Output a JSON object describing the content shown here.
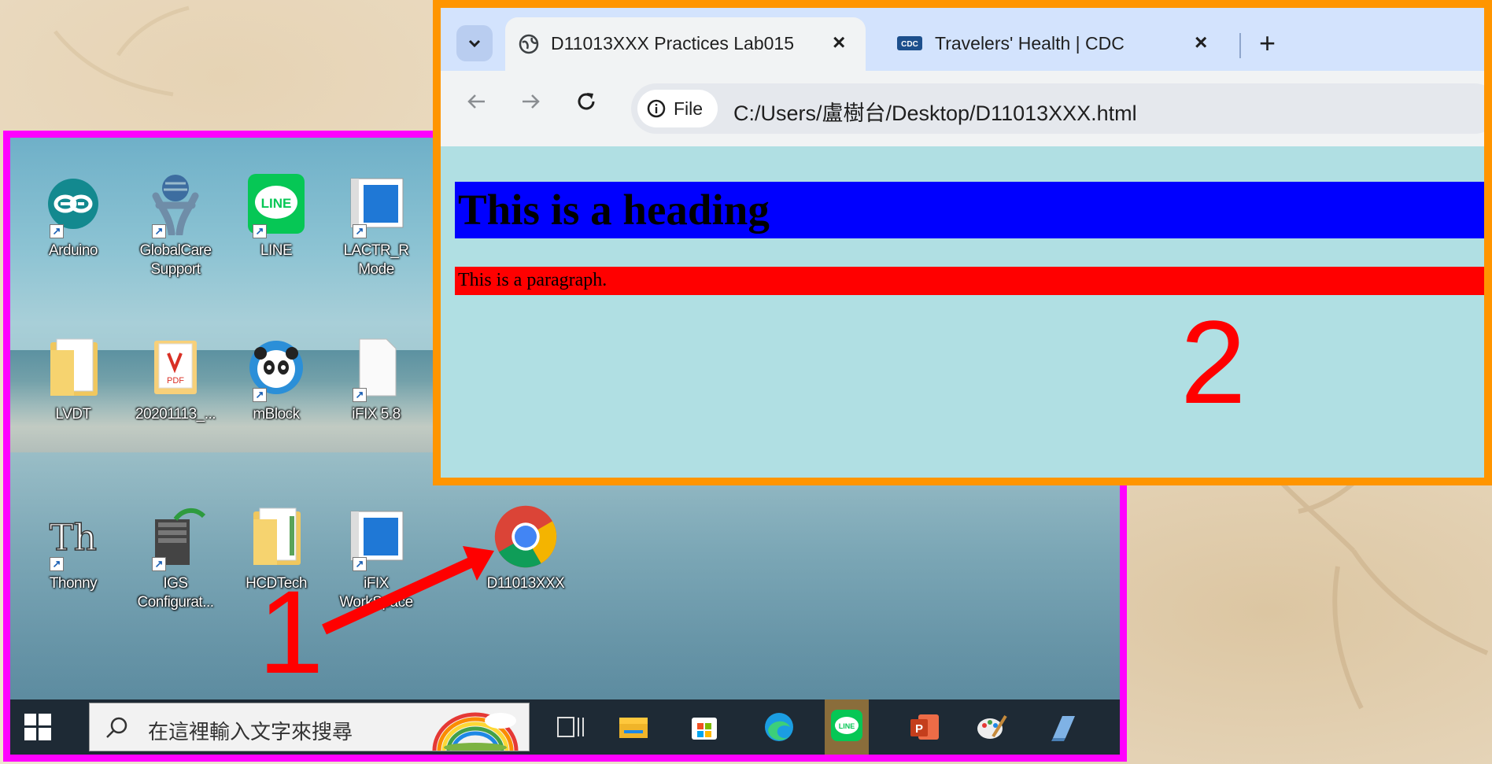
{
  "desktop": {
    "icons": [
      {
        "label": "Arduino",
        "icon": "arduino-icon"
      },
      {
        "label": "GlobalCare Support",
        "icon": "globalcare-icon"
      },
      {
        "label": "LINE",
        "icon": "line-icon"
      },
      {
        "label": "LACTR_R Mode",
        "icon": "window-app-icon"
      },
      {
        "label": "LVDT",
        "icon": "folder-icon"
      },
      {
        "label": "20201113_...",
        "icon": "pdf-icon"
      },
      {
        "label": "mBlock",
        "icon": "mblock-panda-icon"
      },
      {
        "label": "iFIX 5.8",
        "icon": "blank-file-icon"
      },
      {
        "label": "Thonny",
        "icon": "thonny-icon"
      },
      {
        "label": "IGS Configurat...",
        "icon": "igs-server-icon"
      },
      {
        "label": "HCDTech",
        "icon": "folder-icon"
      },
      {
        "label": "iFIX WorkSpace",
        "icon": "window-app-icon"
      },
      {
        "label": "D11013XXX",
        "icon": "chrome-icon"
      }
    ],
    "taskbar": {
      "search_placeholder": "在這裡輸入文字來搜尋",
      "apps": [
        "task-view-icon",
        "file-explorer-icon",
        "microsoft-store-icon",
        "edge-icon",
        "line-icon",
        "powerpoint-icon",
        "paint-icon",
        "notepad-icon"
      ]
    }
  },
  "browser": {
    "tabs": [
      {
        "title": "D11013XXX Practices Lab015",
        "icon": "globe-icon",
        "active": true
      },
      {
        "title": "Travelers' Health | CDC",
        "icon": "cdc-icon",
        "active": false
      }
    ],
    "close_glyph": "×",
    "new_tab_glyph": "+",
    "address": {
      "chip_label": "File",
      "url": "C:/Users/盧樹台/Desktop/D11013XXX.html"
    },
    "page": {
      "heading": "This is a heading",
      "paragraph": "This is a paragraph.",
      "heading_bg": "#0000ff",
      "paragraph_bg": "#ff0000",
      "body_bg": "#b0dfe3"
    }
  },
  "annotations": {
    "step1": "1",
    "step2": "2",
    "color": "#ff0000",
    "desktop_frame_color": "#ff00ff",
    "browser_frame_color": "#ff9500"
  }
}
